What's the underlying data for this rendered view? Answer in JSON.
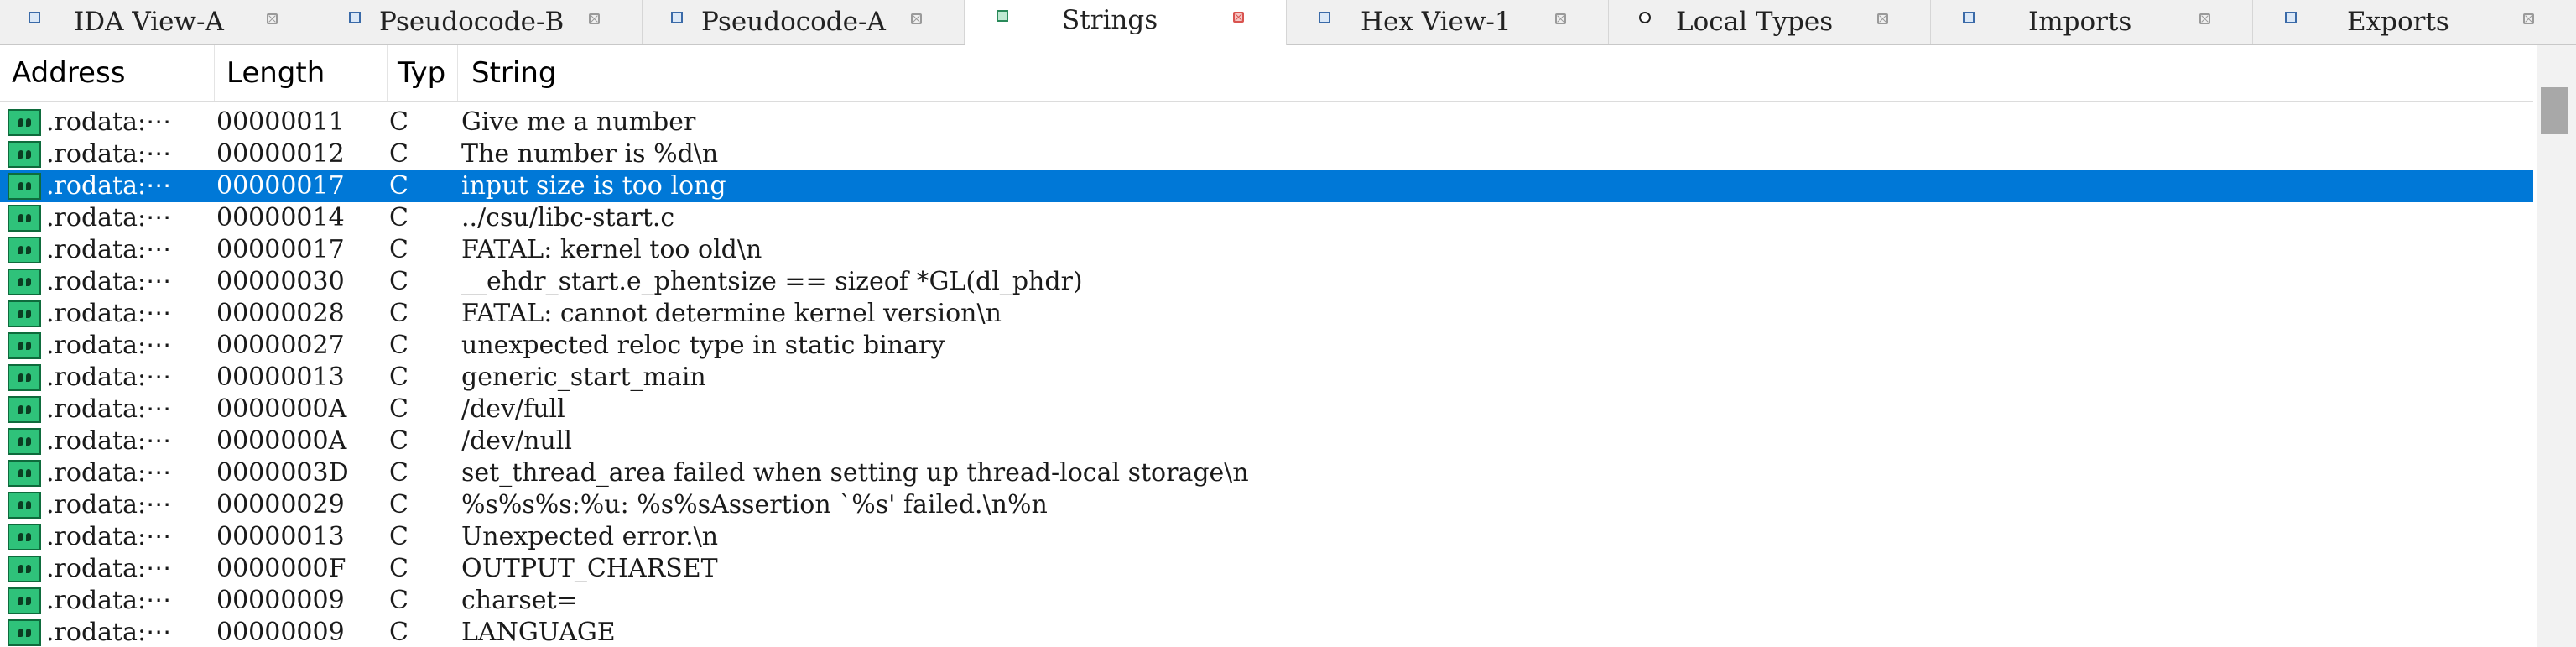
{
  "tabs": [
    {
      "label": "IDA View-A",
      "icon": "ida-view-icon",
      "active": false
    },
    {
      "label": "Pseudocode-B",
      "icon": "pseudocode-icon",
      "active": false
    },
    {
      "label": "Pseudocode-A",
      "icon": "pseudocode-icon",
      "active": false
    },
    {
      "label": "Strings",
      "icon": "strings-icon",
      "active": true
    },
    {
      "label": "Hex View-1",
      "icon": "hex-view-icon",
      "active": false
    },
    {
      "label": "Local Types",
      "icon": "local-types-icon",
      "active": false
    },
    {
      "label": "Imports",
      "icon": "imports-icon",
      "active": false
    },
    {
      "label": "Exports",
      "icon": "exports-icon",
      "active": false
    }
  ],
  "columns": {
    "address": "Address",
    "length": "Length",
    "type": "Typ",
    "string": "String"
  },
  "rows": [
    {
      "address": ".rodata:⋯",
      "length": "00000011",
      "type": "C",
      "string": "Give me a number"
    },
    {
      "address": ".rodata:⋯",
      "length": "00000012",
      "type": "C",
      "string": "The number is %d\\n"
    },
    {
      "address": ".rodata:⋯",
      "length": "00000017",
      "type": "C",
      "string": "input size is too long"
    },
    {
      "address": ".rodata:⋯",
      "length": "00000014",
      "type": "C",
      "string": "../csu/libc-start.c"
    },
    {
      "address": ".rodata:⋯",
      "length": "00000017",
      "type": "C",
      "string": "FATAL: kernel too old\\n"
    },
    {
      "address": ".rodata:⋯",
      "length": "00000030",
      "type": "C",
      "string": "__ehdr_start.e_phentsize == sizeof *GL(dl_phdr)"
    },
    {
      "address": ".rodata:⋯",
      "length": "00000028",
      "type": "C",
      "string": "FATAL: cannot determine kernel version\\n"
    },
    {
      "address": ".rodata:⋯",
      "length": "00000027",
      "type": "C",
      "string": "unexpected reloc type in static binary"
    },
    {
      "address": ".rodata:⋯",
      "length": "00000013",
      "type": "C",
      "string": "generic_start_main"
    },
    {
      "address": ".rodata:⋯",
      "length": "0000000A",
      "type": "C",
      "string": "/dev/full"
    },
    {
      "address": ".rodata:⋯",
      "length": "0000000A",
      "type": "C",
      "string": "/dev/null"
    },
    {
      "address": ".rodata:⋯",
      "length": "0000003D",
      "type": "C",
      "string": "set_thread_area failed when setting up thread-local storage\\n"
    },
    {
      "address": ".rodata:⋯",
      "length": "00000029",
      "type": "C",
      "string": "%s%s%s:%u: %s%sAssertion `%s' failed.\\n%n"
    },
    {
      "address": ".rodata:⋯",
      "length": "00000013",
      "type": "C",
      "string": "Unexpected error.\\n"
    },
    {
      "address": ".rodata:⋯",
      "length": "0000000F",
      "type": "C",
      "string": "OUTPUT_CHARSET"
    },
    {
      "address": ".rodata:⋯",
      "length": "00000009",
      "type": "C",
      "string": "charset="
    },
    {
      "address": ".rodata:⋯",
      "length": "00000009",
      "type": "C",
      "string": "LANGUAGE"
    }
  ],
  "selected_row_index": 2,
  "colors": {
    "selection": "#0078d7",
    "string_icon": "#2fc27a",
    "close_active": "#d9534f"
  }
}
